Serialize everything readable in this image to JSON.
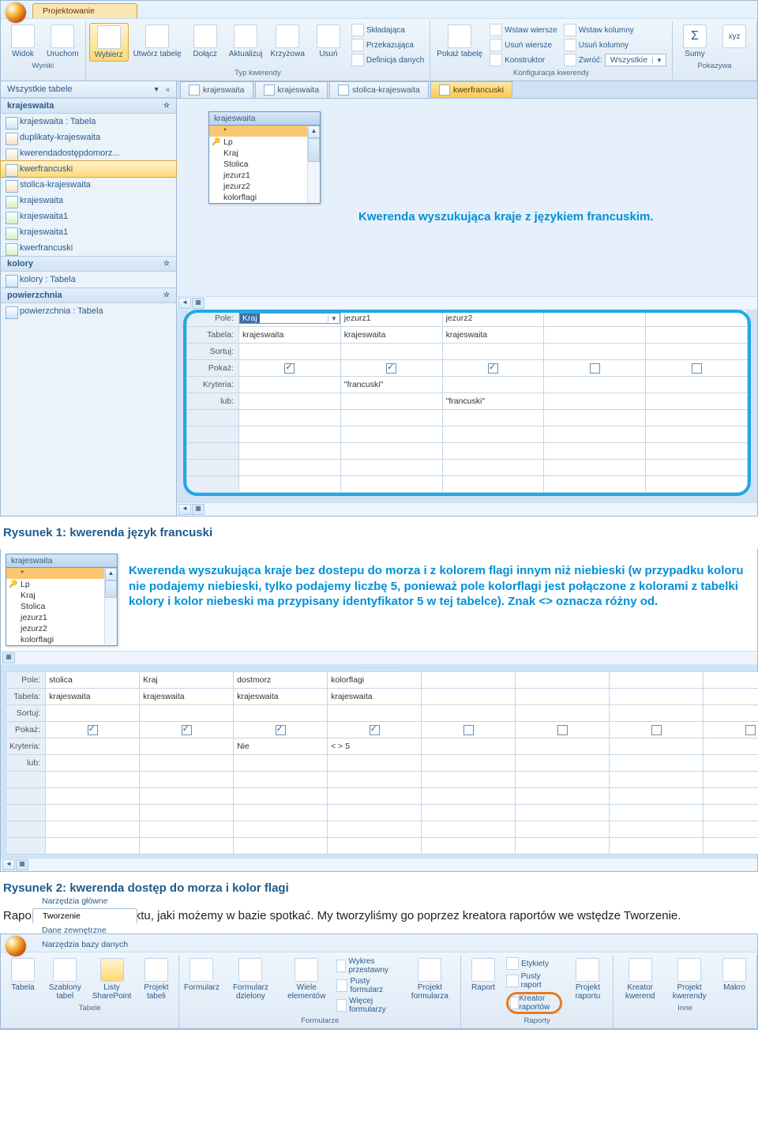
{
  "ribbon1": {
    "tabs": [
      "Narzędzia główne",
      "Tworzenie",
      "Dane zewnętrzne",
      "Narzędzia bazy danych",
      "Projektowanie"
    ],
    "active": 4,
    "groups": {
      "wyniki": {
        "label": "Wyniki",
        "buttons": [
          "Widok",
          "Uruchom"
        ]
      },
      "typ": {
        "label": "Typ kwerendy",
        "select": "Wybierz",
        "buttons": [
          "Utwórz\ntabelę",
          "Dołącz",
          "Aktualizuj",
          "Krzyżowa",
          "Usuń"
        ],
        "small": [
          "Składająca",
          "Przekazująca",
          "Definicja danych"
        ]
      },
      "konfig": {
        "label": "Konfiguracja kwerendy",
        "pokaz": "Pokaż\ntabelę",
        "rowsA": [
          "Wstaw wiersze",
          "Usuń wiersze",
          "Konstruktor"
        ],
        "rowsB": [
          "Wstaw kolumny",
          "Usuń kolumny"
        ],
        "zwroc_lbl": "Zwróć:",
        "zwroc_val": "Wszystkie"
      },
      "pokazywa": {
        "label": "Pokazywa",
        "sumy": "Sumy"
      }
    }
  },
  "nav": {
    "title": "Wszystkie tabele",
    "cats": [
      {
        "name": "krajeswaita",
        "items": [
          {
            "t": "krajeswaita : Tabela",
            "k": "tbl"
          },
          {
            "t": "duplikaty-krajeswaita",
            "k": "qry"
          },
          {
            "t": "kwerendadostępdomorz...",
            "k": "qry"
          },
          {
            "t": "kwerfrancuski",
            "k": "qry",
            "sel": true
          },
          {
            "t": "stolica-krajeswaita",
            "k": "qry"
          },
          {
            "t": "krajeswaita",
            "k": "frm"
          },
          {
            "t": "krajeswaita1",
            "k": "frm"
          },
          {
            "t": "krajeswaita1",
            "k": "frm"
          },
          {
            "t": "kwerfrancuski",
            "k": "frm"
          }
        ]
      },
      {
        "name": "kolory",
        "items": [
          {
            "t": "kolory : Tabela",
            "k": "tbl"
          }
        ]
      },
      {
        "name": "powierzchnia",
        "items": [
          {
            "t": "powierzchnia : Tabela",
            "k": "tbl"
          }
        ]
      }
    ]
  },
  "doctabs": [
    "krajeswaita",
    "krajeswaita",
    "stolica-krajeswaita",
    "kwerfrancuski"
  ],
  "doctab_active": 3,
  "fieldlist": {
    "title": "krajeswaita",
    "fields": [
      "*",
      "Lp",
      "Kraj",
      "Stolica",
      "jezurz1",
      "jezurz2",
      "kolorflagi"
    ]
  },
  "annot1": "Kwerenda wyszukująca kraje z językiem francuskim.",
  "grid1": {
    "labels": [
      "Pole:",
      "Tabela:",
      "Sortuj:",
      "Pokaż:",
      "Kryteria:",
      "lub:"
    ],
    "cols": [
      {
        "pole": "Kraj",
        "tabela": "krajeswaita",
        "pokaz": true,
        "kryt": "",
        "lub": ""
      },
      {
        "pole": "jezurz1",
        "tabela": "krajeswaita",
        "pokaz": true,
        "kryt": "\"francuski\"",
        "lub": ""
      },
      {
        "pole": "jezurz2",
        "tabela": "krajeswaita",
        "pokaz": true,
        "kryt": "",
        "lub": "\"francuski\""
      },
      {
        "pole": "",
        "tabela": "",
        "pokaz": false,
        "kryt": "",
        "lub": ""
      },
      {
        "pole": "",
        "tabela": "",
        "pokaz": false,
        "kryt": "",
        "lub": ""
      }
    ]
  },
  "caption1": "Rysunek 1: kwerenda język francuski",
  "fieldlist2": {
    "title": "krajeswaita",
    "fields": [
      "*",
      "Lp",
      "Kraj",
      "Stolica",
      "jezurz1",
      "jezurz2",
      "kolorflagi"
    ]
  },
  "annot2": "Kwerenda wyszukująca kraje bez dostepu do morza i z kolorem flagi innym niż niebieski (w przypadku koloru nie podajemy niebieski, tylko podajemy liczbę 5, ponieważ pole kolorflagi jest połączone z kolorami z tabelki kolory i kolor niebeski ma przypisany identyfikator 5 w tej tabelce). Znak <> oznacza różny od.",
  "grid2": {
    "labels": [
      "Pole:",
      "Tabela:",
      "Sortuj:",
      "Pokaż:",
      "Kryteria:",
      "lub:"
    ],
    "cols": [
      {
        "pole": "stolica",
        "tabela": "krajeswaita",
        "pokaz": true,
        "kryt": "",
        "lub": ""
      },
      {
        "pole": "Kraj",
        "tabela": "krajeswaita",
        "pokaz": true,
        "kryt": "",
        "lub": ""
      },
      {
        "pole": "dostmorz",
        "tabela": "krajeswaita",
        "pokaz": true,
        "kryt": "Nie",
        "lub": ""
      },
      {
        "pole": "kolorflagi",
        "tabela": "krajeswaita",
        "pokaz": true,
        "kryt": "< > 5",
        "lub": ""
      },
      {
        "pole": "",
        "tabela": "",
        "pokaz": false,
        "kryt": "",
        "lub": ""
      },
      {
        "pole": "",
        "tabela": "",
        "pokaz": false,
        "kryt": "",
        "lub": ""
      },
      {
        "pole": "",
        "tabela": "",
        "pokaz": false,
        "kryt": "",
        "lub": ""
      },
      {
        "pole": "",
        "tabela": "",
        "pokaz": false,
        "kryt": "",
        "lub": ""
      }
    ]
  },
  "caption2": "Rysunek 2: kwerenda dostęp do morza i kolor flagi",
  "bodytext": "Raport to ostatni typ obiektu, jaki możemy w bazie spotkać. My tworzyliśmy go poprzez kreatora raportów we wstędze Tworzenie.",
  "ribbon2": {
    "tabs": [
      "Narzędzia główne",
      "Tworzenie",
      "Dane zewnętrzne",
      "Narzędzia bazy danych"
    ],
    "active": 1,
    "groups": {
      "tabele": {
        "label": "Tabele",
        "buttons": [
          "Tabela",
          "Szablony\ntabel",
          "Listy\nSharePoint",
          "Projekt\ntabeli"
        ]
      },
      "form": {
        "label": "Formularze",
        "buttons": [
          "Formularz",
          "Formularz\ndzielony",
          "Wiele\nelementów"
        ],
        "small": [
          "Wykres przestawny",
          "Pusty formularz",
          "Więcej formularzy"
        ],
        "proj": "Projekt\nformularza"
      },
      "raporty": {
        "label": "Raporty",
        "raport": "Raport",
        "small": [
          "Etykiety",
          "Pusty raport"
        ],
        "kreator": "Kreator raportów",
        "proj": "Projekt\nraportu"
      },
      "inne": {
        "label": "Inne",
        "buttons": [
          "Kreator\nkwerend",
          "Projekt\nkwerendy",
          "Makro"
        ]
      }
    }
  }
}
